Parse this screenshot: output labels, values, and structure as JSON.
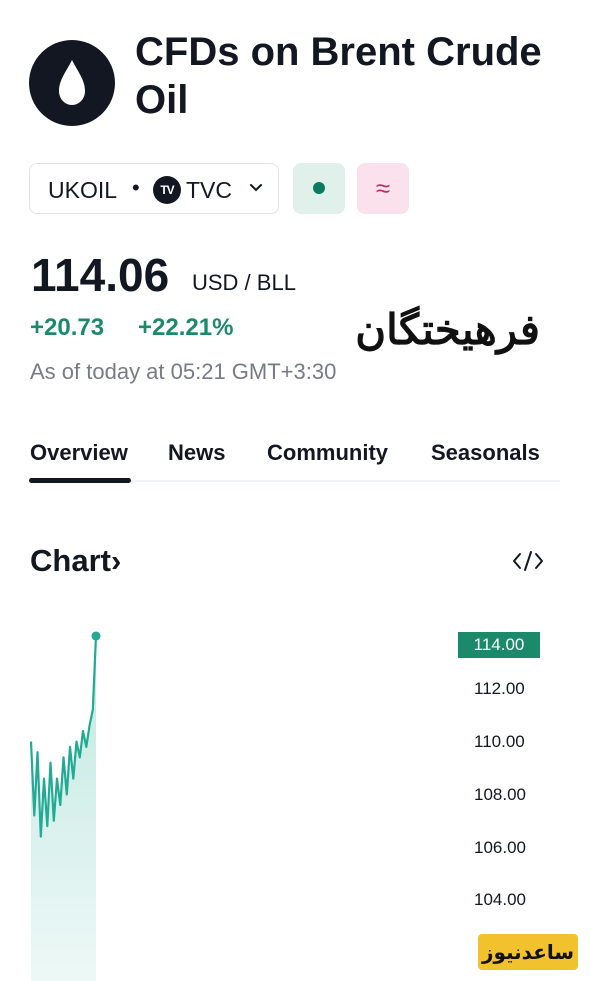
{
  "header": {
    "title": "CFDs on Brent Crude Oil",
    "logo_icon": "oil-drop-icon"
  },
  "symbol": {
    "ticker": "UKOIL",
    "separator": "•",
    "exchange_badge": "TV",
    "exchange": "TVC"
  },
  "actions": {
    "approx_label": "≈"
  },
  "quote": {
    "price": "114.06",
    "currency": "USD / BLL",
    "change_abs": "+20.73",
    "change_pct": "+22.21%",
    "as_of": "As of today at 05:21 GMT+3:30"
  },
  "watermark_text": "فرهیختگان",
  "tabs": [
    {
      "label": "Overview",
      "active": true
    },
    {
      "label": "News"
    },
    {
      "label": "Community"
    },
    {
      "label": "Seasonals"
    }
  ],
  "chart_section": {
    "title": "Chart",
    "chevron": "›"
  },
  "colors": {
    "positive": "#1b8a6b",
    "line": "#22ab94"
  },
  "chart_data": {
    "type": "area",
    "current_value_label": "114.00",
    "y_ticks": [
      "112.00",
      "110.00",
      "108.00",
      "106.00",
      "104.00"
    ],
    "ylim": [
      102.5,
      114.8
    ],
    "values": [
      110.0,
      107.2,
      109.6,
      106.4,
      108.6,
      106.8,
      109.2,
      107.0,
      108.6,
      107.6,
      109.4,
      108.0,
      109.8,
      108.6,
      110.0,
      109.4,
      110.4,
      109.8,
      110.6,
      111.2,
      114.0
    ],
    "grid": false
  },
  "badge_text": "ساعدنیوز"
}
